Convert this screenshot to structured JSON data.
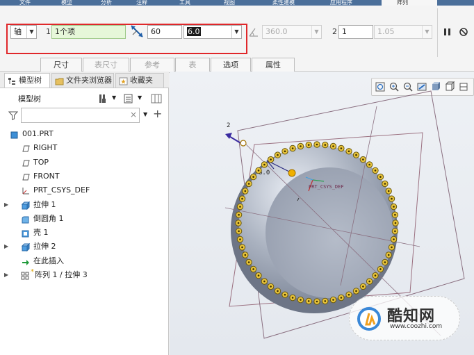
{
  "ribbon": {
    "tabs": [
      "文件",
      "模型",
      "分析",
      "注释",
      "工具",
      "视图",
      "柔性建模",
      "应用程序",
      "阵列"
    ]
  },
  "dashboard": {
    "type_select": "轴",
    "dir1_index": "1",
    "dir1_items": "1个项",
    "count": "60",
    "increment": "6.0",
    "extent": "360.0",
    "dir2_index": "2",
    "dir2_count": "1",
    "dir2_increment": "1.05"
  },
  "slideup_tabs": [
    "尺寸",
    "表尺寸",
    "参考",
    "表",
    "选项",
    "属性"
  ],
  "navigator": {
    "tabs": [
      "模型树",
      "文件夹浏览器",
      "收藏夹"
    ],
    "header": "模型树",
    "search_placeholder": "",
    "tree": [
      {
        "label": "001.PRT",
        "icon": "part-icon",
        "indent": 0,
        "expand": ""
      },
      {
        "label": "RIGHT",
        "icon": "datum-plane-icon",
        "indent": 1,
        "expand": ""
      },
      {
        "label": "TOP",
        "icon": "datum-plane-icon",
        "indent": 1,
        "expand": ""
      },
      {
        "label": "FRONT",
        "icon": "datum-plane-icon",
        "indent": 1,
        "expand": ""
      },
      {
        "label": "PRT_CSYS_DEF",
        "icon": "csys-icon",
        "indent": 1,
        "expand": ""
      },
      {
        "label": "拉伸 1",
        "icon": "extrude-icon",
        "indent": 1,
        "expand": "▶"
      },
      {
        "label": "倒圆角 1",
        "icon": "round-icon",
        "indent": 1,
        "expand": ""
      },
      {
        "label": "壳 1",
        "icon": "shell-icon",
        "indent": 1,
        "expand": ""
      },
      {
        "label": "拉伸 2",
        "icon": "extrude-icon",
        "indent": 1,
        "expand": "▶"
      },
      {
        "label": "在此插入",
        "icon": "insert-arrow-icon",
        "indent": 1,
        "expand": ""
      },
      {
        "label": "阵列 1 / 拉伸 3",
        "icon": "pattern-icon",
        "indent": 1,
        "expand": "▶"
      }
    ]
  },
  "graphics": {
    "dim_labels": [
      "2",
      "6.0"
    ],
    "csys_label": "PRT_CSYS_DEF",
    "pattern_count": 60
  },
  "watermark": {
    "title": "酷知网",
    "url": "www.coozhi.com"
  },
  "colors": {
    "accent_red": "#e0272a",
    "ribbon_blue": "#4b6f9a",
    "pattern_yellow": "#e8c33a",
    "part_gray": "#a9b1bf"
  }
}
